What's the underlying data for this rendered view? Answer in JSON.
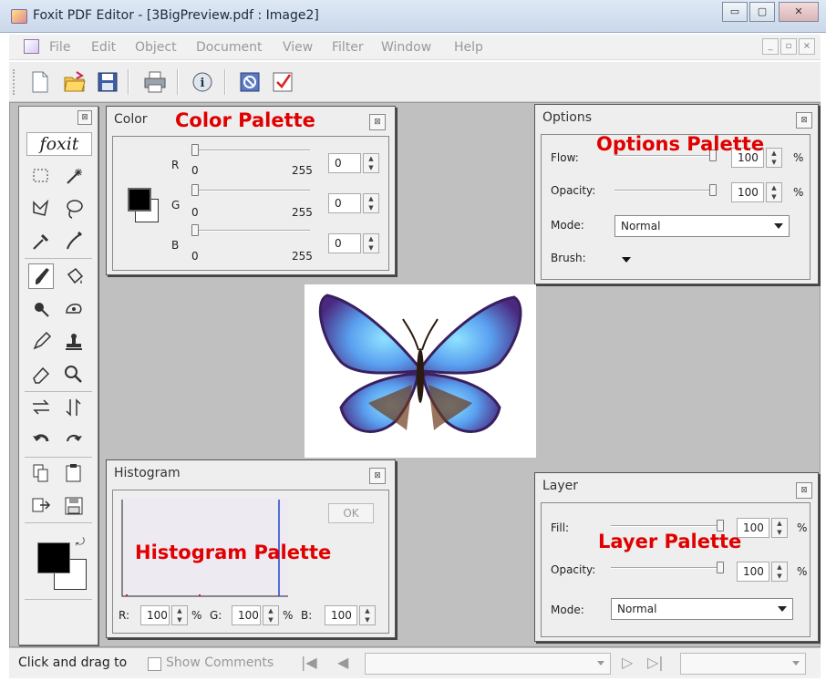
{
  "window": {
    "title": "Foxit PDF Editor - [3BigPreview.pdf : Image2]"
  },
  "menu": [
    "File",
    "Edit",
    "Object",
    "Document",
    "View",
    "Filter",
    "Window",
    "Help"
  ],
  "toolbar": [
    "new-document",
    "open-folder",
    "save",
    "print",
    "info",
    "stop",
    "check"
  ],
  "tools_palette": {
    "brand": "foxit"
  },
  "color_palette": {
    "title": "Color",
    "annotation": "Color Palette",
    "channels": [
      {
        "label": "R",
        "min": "0",
        "max": "255",
        "value": "0"
      },
      {
        "label": "G",
        "min": "0",
        "max": "255",
        "value": "0"
      },
      {
        "label": "B",
        "min": "0",
        "max": "255",
        "value": "0"
      }
    ]
  },
  "options_palette": {
    "title": "Options",
    "annotation": "Options Palette",
    "flow_label": "Flow:",
    "flow_value": "100",
    "flow_unit": "%",
    "opacity_label": "Opacity:",
    "opacity_value": "100",
    "opacity_unit": "%",
    "mode_label": "Mode:",
    "mode_value": "Normal",
    "brush_label": "Brush:"
  },
  "histogram_palette": {
    "title": "Histogram",
    "annotation": "Histogram Palette",
    "ok_label": "OK",
    "r_label": "R:",
    "r_value": "100",
    "r_unit": "%",
    "g_label": "G:",
    "g_value": "100",
    "g_unit": "%",
    "b_label": "B:",
    "b_value": "100"
  },
  "layer_palette": {
    "title": "Layer",
    "annotation": "Layer Palette",
    "fill_label": "Fill:",
    "fill_value": "100",
    "fill_unit": "%",
    "opacity_label": "Opacity:",
    "opacity_value": "100",
    "opacity_unit": "%",
    "mode_label": "Mode:",
    "mode_value": "Normal"
  },
  "statusbar": {
    "hint": "Click and drag to",
    "show_comments": "Show Comments"
  },
  "colors": {
    "annotation": "#e00000",
    "workspace": "#c0c0c0",
    "foreground": "#000000",
    "background": "#ffffff"
  }
}
